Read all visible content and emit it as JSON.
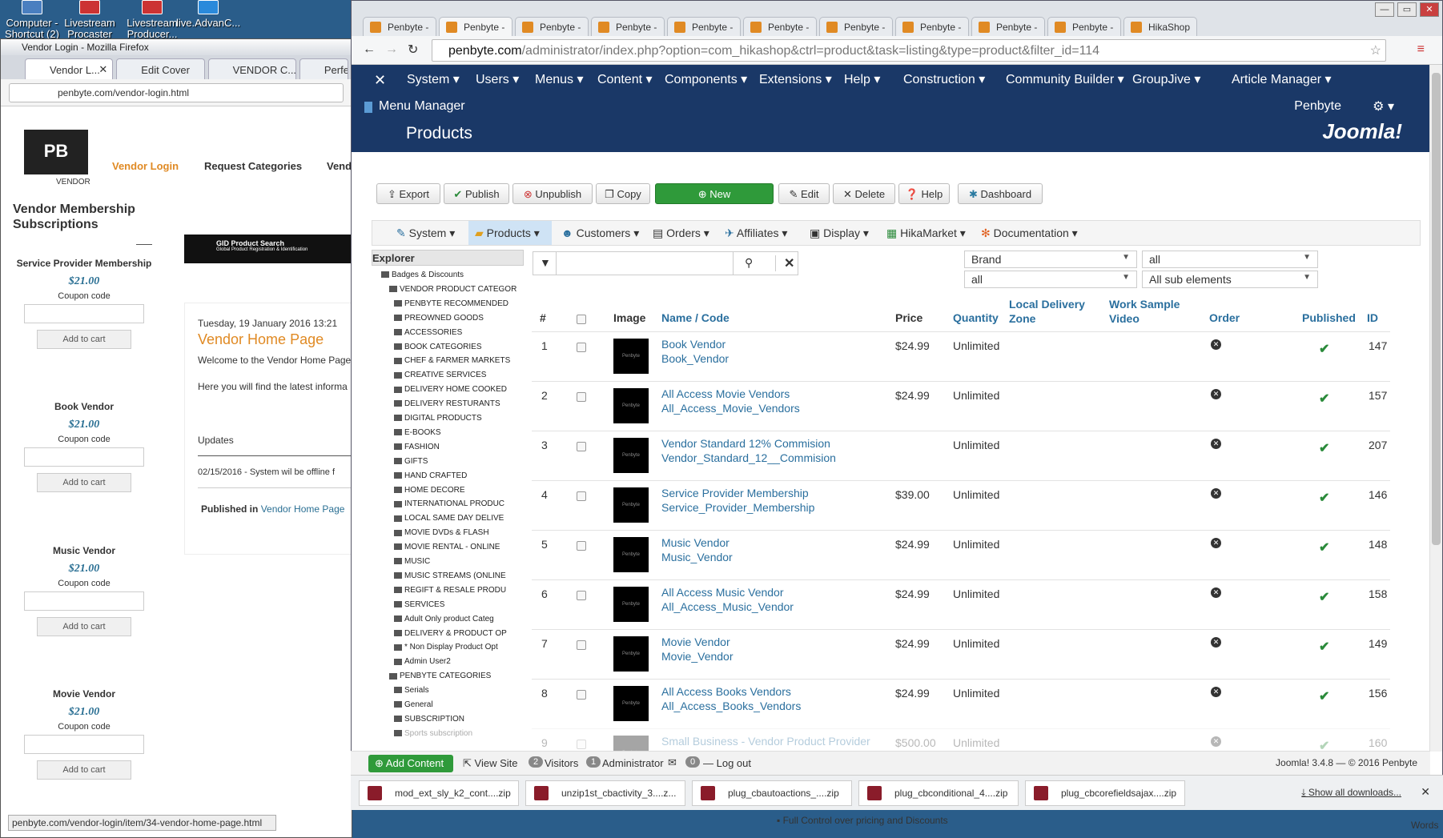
{
  "desktop": {
    "icons": [
      {
        "label": "Computer -\nShortcut (2)"
      },
      {
        "label": "Livestream\nProcaster"
      },
      {
        "label": "Livestream\nProducer..."
      },
      {
        "label": "live.AdvanC..."
      }
    ]
  },
  "firefox": {
    "title": "Vendor Login - Mozilla Firefox",
    "tabs": [
      "Vendor L...",
      "Edit Cover",
      "VENDOR C...",
      "Perfect Sol"
    ],
    "url": "penbyte.com/vendor-login.html",
    "logo_text": "PB",
    "logo_sub": "VENDOR",
    "nav": [
      "Vendor Login",
      "Request Categories",
      "Vend"
    ],
    "sidebar_title": "Vendor Membership Subscriptions",
    "banner_title": "GID Product Search",
    "banner_sub": "Global Product Registration & Identification",
    "vendors": [
      {
        "name": "Service Provider Membership",
        "price": "$21.00",
        "coupon": "Coupon code",
        "btn": "Add to cart"
      },
      {
        "name": "Book Vendor",
        "price": "$21.00",
        "coupon": "Coupon code",
        "btn": "Add to cart"
      },
      {
        "name": "Music Vendor",
        "price": "$21.00",
        "coupon": "Coupon code",
        "btn": "Add to cart"
      },
      {
        "name": "Movie Vendor",
        "price": "$21.00",
        "coupon": "Coupon code",
        "btn": "Add to cart"
      }
    ],
    "article": {
      "date": "Tuesday, 19 January 2016 13:21",
      "heading": "Vendor Home Page",
      "p1": "Welcome to the Vendor Home Page",
      "p2": "Here you will find the latest informa",
      "updates": "Updates",
      "update1": "02/15/2016 - System wil be offline f",
      "published_in": "Published in",
      "published_link": "Vendor Home Page"
    },
    "status_url": "penbyte.com/vendor-login/item/34-vendor-home-page.html"
  },
  "chrome": {
    "tabs": [
      "Penbyte -",
      "Penbyte -",
      "Penbyte -",
      "Penbyte -",
      "Penbyte -",
      "Penbyte -",
      "Penbyte -",
      "Penbyte -",
      "Penbyte -",
      "Penbyte -",
      "HikaShop"
    ],
    "url_host": "penbyte.com",
    "url_path": "/administrator/index.php?option=com_hikashop&ctrl=product&task=listing&type=product&filter_id=114"
  },
  "joomla": {
    "menu": [
      "System",
      "Users",
      "Menus",
      "Content",
      "Components",
      "Extensions",
      "Help",
      "Construction",
      "Community Builder",
      "GroupJive",
      "Article Manager"
    ],
    "submenu": "Menu Manager",
    "user": "Penbyte",
    "page_title": "Products",
    "logo": "Joomla!",
    "toolbar": [
      "Export",
      "Publish",
      "Unpublish",
      "Copy",
      "New",
      "Edit",
      "Delete",
      "Help",
      "Dashboard"
    ],
    "hika_menu": [
      "System",
      "Products",
      "Customers",
      "Orders",
      "Affiliates",
      "Display",
      "HikaMarket",
      "Documentation"
    ],
    "explorer_title": "Explorer",
    "tree": [
      "Badges & Discounts",
      "VENDOR PRODUCT CATEGOR",
      "PENBYTE RECOMMENDED",
      "PREOWNED GOODS",
      "ACCESSORIES",
      "BOOK CATEGORIES",
      "CHEF & FARMER MARKETS",
      "CREATIVE SERVICES",
      "DELIVERY HOME COOKED",
      "DELIVERY RESTURANTS",
      "DIGITAL PRODUCTS",
      "E-BOOKS",
      "FASHION",
      "GIFTS",
      "HAND CRAFTED",
      "HOME DECORE",
      "INTERNATIONAL PRODUC",
      "LOCAL SAME DAY DELIVE",
      "MOVIE DVDs & FLASH",
      "MOVIE RENTAL - ONLINE",
      "MUSIC",
      "MUSIC STREAMS (ONLINE",
      "REGIFT & RESALE PRODU",
      "SERVICES",
      "Adult Only product Categ",
      "DELIVERY & PRODUCT OP",
      "* Non Display Product Opt",
      "Admin User2",
      "PENBYTE CATEGORIES",
      "Serials",
      "General",
      "SUBSCRIPTION",
      "Sports subscription"
    ],
    "filters": {
      "brand": "Brand",
      "all1": "all",
      "all2": "all",
      "sub": "All sub elements"
    },
    "columns": [
      "#",
      "Image",
      "Name / Code",
      "Price",
      "Quantity",
      "Local Delivery Zone",
      "Work Sample Video",
      "Order",
      "Published",
      "ID"
    ],
    "products": [
      {
        "n": "1",
        "name": "Book Vendor",
        "code": "Book_Vendor",
        "price": "$24.99",
        "qty": "Unlimited",
        "id": "147"
      },
      {
        "n": "2",
        "name": "All Access Movie Vendors",
        "code": "All_Access_Movie_Vendors",
        "price": "$24.99",
        "qty": "Unlimited",
        "id": "157"
      },
      {
        "n": "3",
        "name": "Vendor Standard 12% Commision",
        "code": "Vendor_Standard_12__Commision",
        "price": "",
        "qty": "Unlimited",
        "id": "207"
      },
      {
        "n": "4",
        "name": "Service Provider Membership",
        "code": "Service_Provider_Membership",
        "price": "$39.00",
        "qty": "Unlimited",
        "id": "146"
      },
      {
        "n": "5",
        "name": "Music Vendor",
        "code": "Music_Vendor",
        "price": "$24.99",
        "qty": "Unlimited",
        "id": "148"
      },
      {
        "n": "6",
        "name": "All Access Music Vendor",
        "code": "All_Access_Music_Vendor",
        "price": "$24.99",
        "qty": "Unlimited",
        "id": "158"
      },
      {
        "n": "7",
        "name": "Movie Vendor",
        "code": "Movie_Vendor",
        "price": "$24.99",
        "qty": "Unlimited",
        "id": "149"
      },
      {
        "n": "8",
        "name": "All Access Books Vendors",
        "code": "All_Access_Books_Vendors",
        "price": "$24.99",
        "qty": "Unlimited",
        "id": "156"
      },
      {
        "n": "9",
        "name": "Small Business - Vendor Product Provider",
        "code": "",
        "price": "$500.00",
        "qty": "Unlimited",
        "id": "160"
      }
    ],
    "status": {
      "add_content": "Add Content",
      "view_site": "View Site",
      "visitors_count": "2",
      "visitors": "Visitors",
      "admin_count": "1",
      "admin": "Administrator",
      "msg_count": "0",
      "logout": "Log out",
      "version": "Joomla! 3.4.8 — © 2016 Penbyte"
    }
  },
  "downloads": {
    "items": [
      "mod_ext_sly_k2_cont....zip",
      "unzip1st_cbactivity_3....z...",
      "plug_cbautoactions_....zip",
      "plug_cbconditional_4....zip",
      "plug_cbcorefieldsajax....zip"
    ],
    "show_all": "Show all downloads...",
    "footer_text": "Full Control over pricing and Discounts",
    "words": "Words"
  }
}
